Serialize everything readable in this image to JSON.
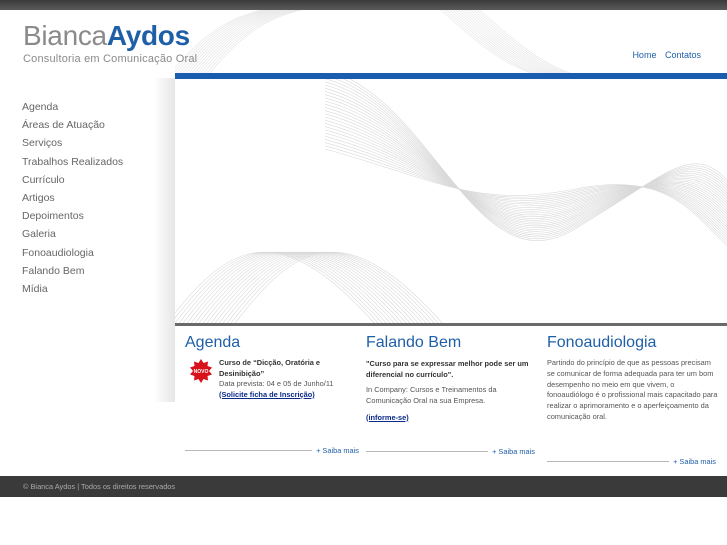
{
  "brand": {
    "first": "Bianca",
    "last": "Aydos",
    "tagline": "Consultoria em Comunicação Oral",
    "color_primary": "#1f5fa8",
    "color_gray": "#8a8a8a"
  },
  "topnav": {
    "home": "Home",
    "contatos": "Contatos"
  },
  "sidebar": {
    "items": [
      {
        "label": "Agenda"
      },
      {
        "label": "Áreas de Atuação"
      },
      {
        "label": "Serviços"
      },
      {
        "label": "Trabalhos Realizados"
      },
      {
        "label": "Currículo"
      },
      {
        "label": "Artigos"
      },
      {
        "label": "Depoimentos"
      },
      {
        "label": "Galeria"
      },
      {
        "label": "Fonoaudiologia"
      },
      {
        "label": "Falando Bem"
      },
      {
        "label": "Mídia"
      }
    ]
  },
  "agenda": {
    "heading": "Agenda",
    "badge": "NOVO",
    "title": "Curso de “Dicção, Oratória e Desinibição”",
    "date": "Data prevista: 04 e 05 de Junho/11",
    "link": "(Solicite ficha de Inscrição)",
    "more": "+ Saiba mais"
  },
  "falando_bem": {
    "heading": "Falando Bem",
    "quote": "\"Curso para se expressar melhor pode ser um diferencial no currículo\".",
    "text": "In Company: Cursos e Treinamentos da Comunicação Oral na sua Empresa.",
    "link": "(informe-se)",
    "more": "+ Saiba mais"
  },
  "fonoaudiologia": {
    "heading": "Fonoaudiologia",
    "text": "Partindo do princípio de que as pessoas precisam se comunicar de forma adequada para ter um bom desempenho no meio em que vivem, o fonoaudiólogo é o profissional mais capacitado para realizar o aprimoramento e o aperfeiçoamento da comunicação oral.",
    "more": "+ Saiba mais"
  },
  "footer": {
    "copyright": "© Bianca Aydos | Todos os direitos reservados"
  }
}
